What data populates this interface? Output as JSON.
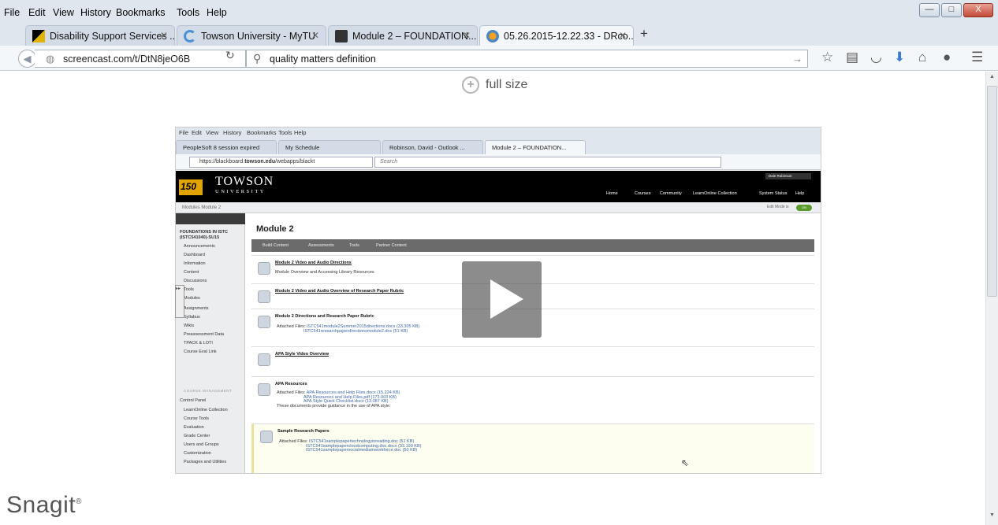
{
  "browser": {
    "menu": [
      "File",
      "Edit",
      "View",
      "History",
      "Bookmarks",
      "Tools",
      "Help"
    ],
    "window_controls": {
      "minimize": "—",
      "maximize": "□",
      "close": "X"
    },
    "tabs": [
      {
        "label": "Disability Support Services ...",
        "active": false
      },
      {
        "label": "Towson University - MyTU",
        "active": false
      },
      {
        "label": "Module 2 – FOUNDATION...",
        "active": false
      },
      {
        "label": "05.26.2015-12.22.33 - DRco...",
        "active": true
      }
    ],
    "new_tab": "+",
    "url": "screencast.com/t/DtN8jeO6B",
    "search": "quality matters definition",
    "toolbar_icons": [
      "star-icon",
      "reading-list-icon",
      "pocket-icon",
      "download-icon",
      "home-icon",
      "chat-icon",
      "menu-icon"
    ]
  },
  "page": {
    "full_size_label": "full size",
    "brand": "Snagit"
  },
  "video": {
    "menu": [
      "File",
      "Edit",
      "View",
      "History",
      "Bookmarks",
      "Tools",
      "Help"
    ],
    "tabs": [
      {
        "label": "PeopleSoft 8 session expired"
      },
      {
        "label": "My Schedule"
      },
      {
        "label": "Robinson, David - Outlook ..."
      },
      {
        "label": "Module 2 – FOUNDATION..."
      }
    ],
    "url_prefix": "https://blackboard.",
    "url_domain": "towson.edu",
    "url_suffix": "/webapps/blackt",
    "search_placeholder": "Search",
    "logo_150": "150",
    "logo_big": "TOWSON",
    "logo_small": "UNIVERSITY",
    "topnav": [
      "Home",
      "Courses",
      "Community",
      "LearnOnline Collection",
      "System Status",
      "Help"
    ],
    "user": "Dale Robinson",
    "breadcrumb": "Modules  Module 2",
    "edit_mode": "Edit Mode is",
    "edit_toggle": "ON",
    "course_title": "FOUNDATIONS IN ISTC (ISTC541040)-SU15",
    "nav_links": [
      "Announcements",
      "Dashboard",
      "Information",
      "Content",
      "Discussions",
      "Tools",
      "Modules",
      "Assignments",
      "Syllabus",
      "Wikis",
      "Preassessment Data",
      "TPACK & LOTI",
      "Course Eval Link"
    ],
    "management_label": "COURSE MANAGEMENT",
    "control_panel": "Control Panel",
    "cp_links": [
      "LearnOnline Collection",
      "Course Tools",
      "Evaluation",
      "Grade Center",
      "Users and Groups",
      "Customization",
      "Packages and Utilities"
    ],
    "module_title": "Module 2",
    "toolbar": [
      "Build Content",
      "Assessments",
      "Tools",
      "Partner Content"
    ],
    "items": [
      {
        "title": "Module 2 Video and Audio Directions",
        "desc": "Module Overview and Accessing Library Resources"
      },
      {
        "title": "Module 2 Video and Audio Overview of Research Paper Rubric",
        "desc": ""
      },
      {
        "title": "Module 2 Directions and Research Paper Rubric",
        "files_label": "Attached Files:",
        "files": [
          "ISTC541module2Summer2015directions.docx (33.305 KB)",
          "ISTC541researchpaperdirectionsmodule2.doc (51 KB)"
        ]
      },
      {
        "title": "APA Style Video Overview",
        "desc": ""
      },
      {
        "title": "APA Resources",
        "files_label": "Attached Files:",
        "files": [
          "APA Resources and Help Files.docx (15.224 KB)",
          "APA Resources and Help Files.pdf (173.003 KB)",
          "APA Style Quick Checklist.docx (13.087 KB)"
        ],
        "note": "These documents provide guidance in the use of APA style."
      },
      {
        "title": "Sample Research Papers",
        "files_label": "Attached Files:",
        "files": [
          "ISTC541samplepapertechnologyinreading.doc (51 KB)",
          "ISTC541samplepapercloudcomputing.doc.docx (33.199 KB)",
          "ISTC541samplepapersocialmediainworkforce.doc (50 KB)"
        ]
      }
    ]
  }
}
